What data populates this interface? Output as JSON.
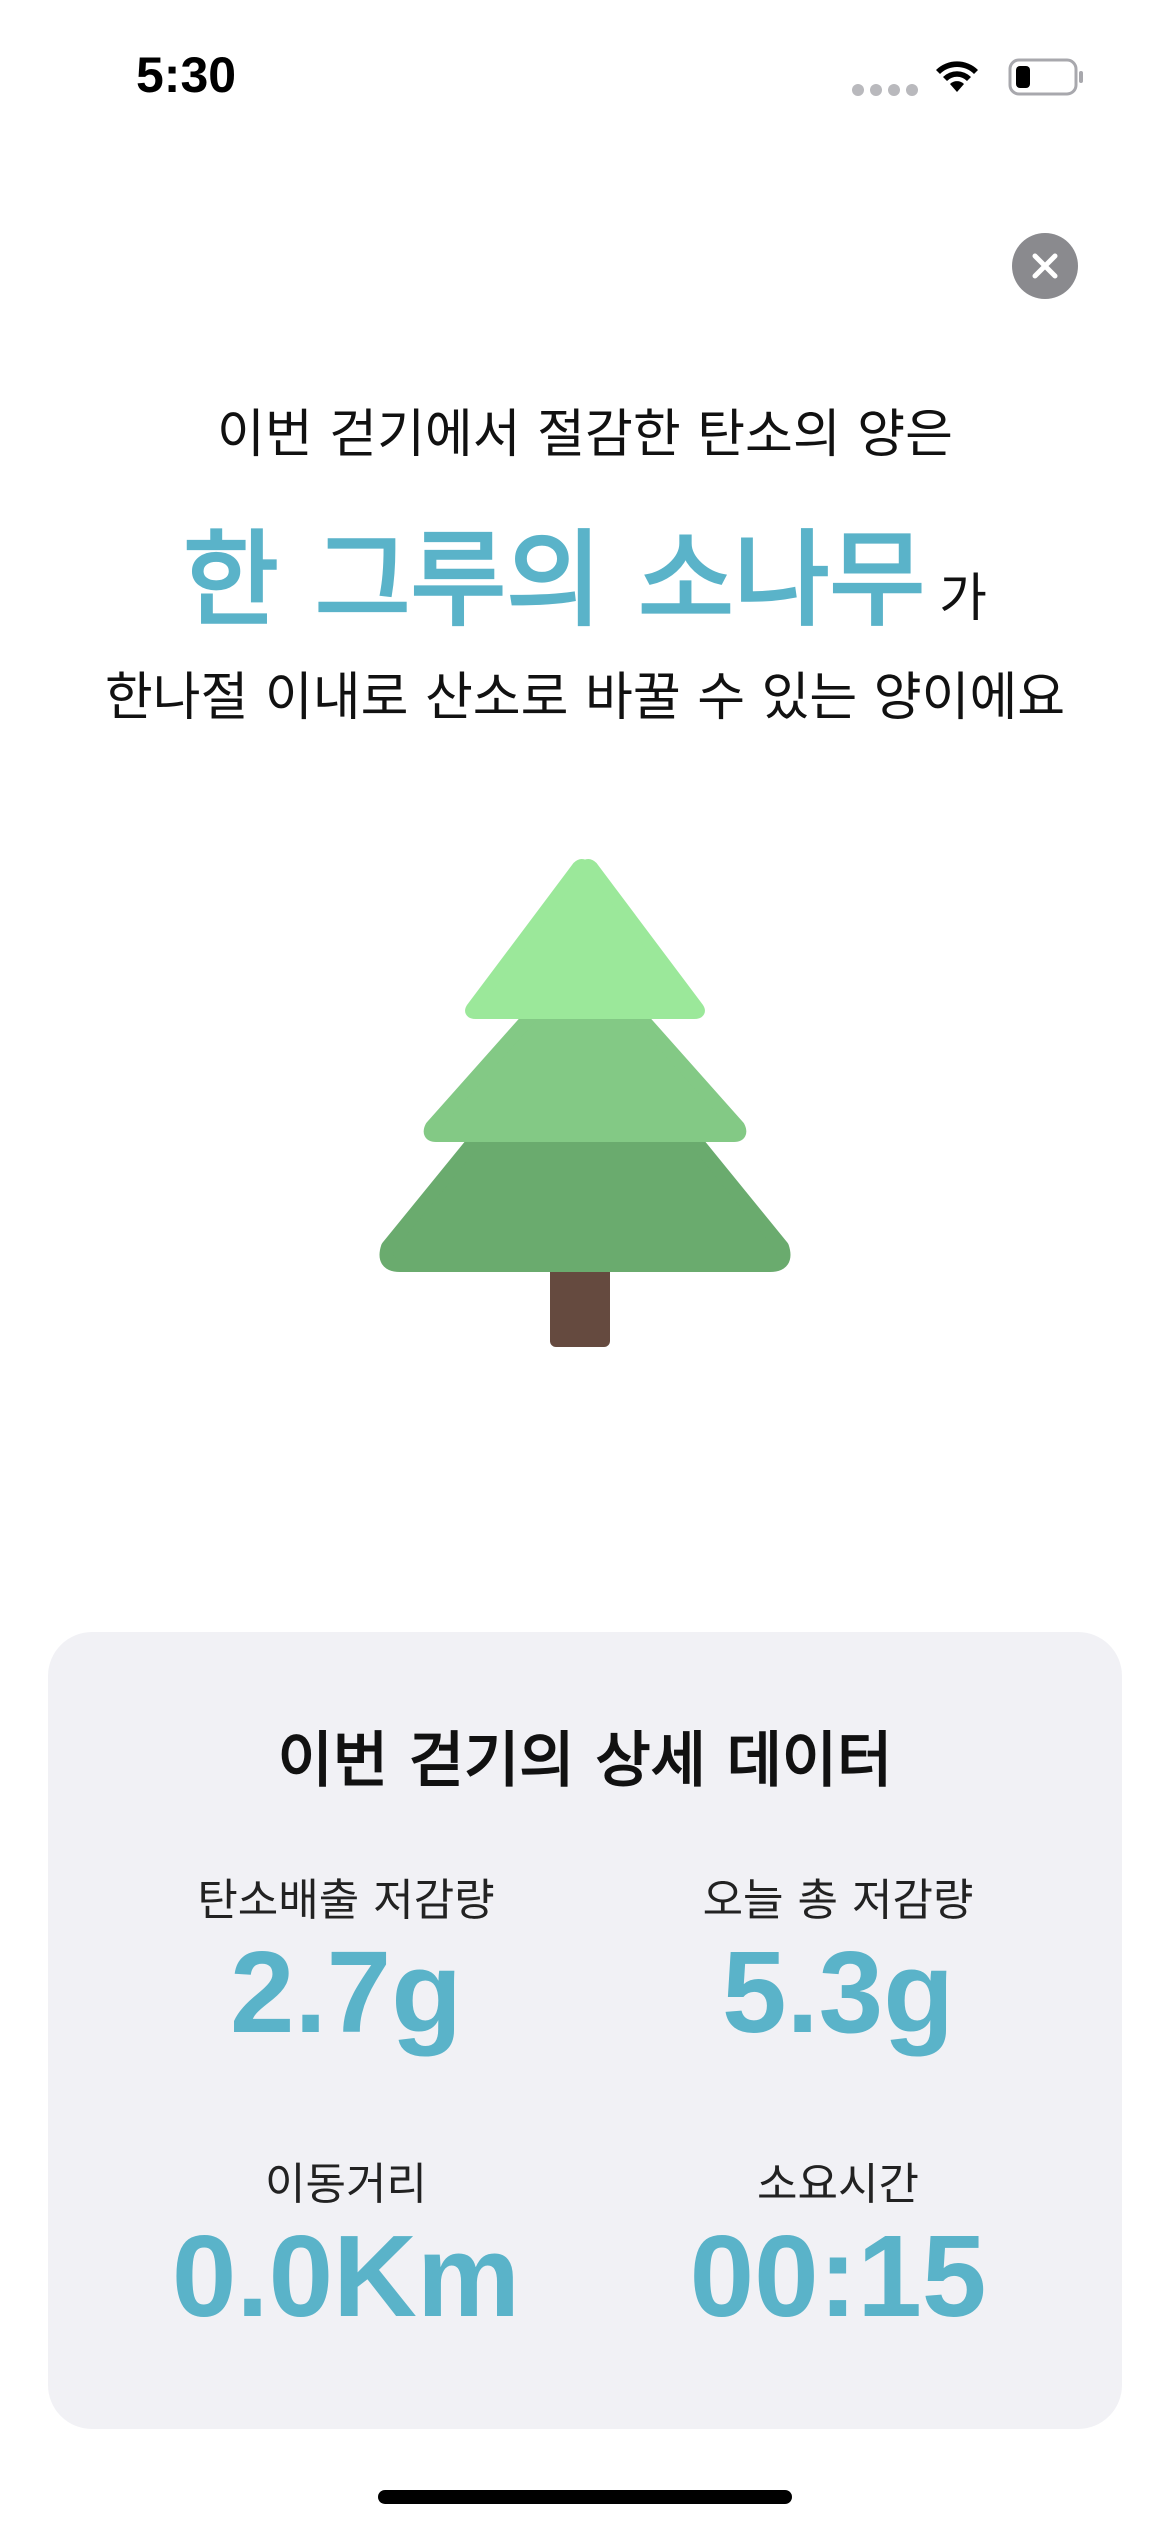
{
  "status_bar": {
    "time": "5:30"
  },
  "headline": {
    "line1": "이번 걷기에서 절감한 탄소의 양은",
    "highlight": "한 그루의 소나무",
    "particle": "가",
    "line3": "한나절 이내로 산소로 바꿀 수 있는 양이에요"
  },
  "colors": {
    "accent": "#5ab3c9",
    "tree_top": "#9be89a",
    "tree_middle": "#83c985",
    "tree_bottom": "#6aab6e",
    "trunk": "#654a3f",
    "card_bg": "#f1f1f5",
    "close_bg": "#8a8a8e"
  },
  "detail": {
    "title": "이번 걷기의 상세 데이터",
    "stats": [
      {
        "label": "탄소배출 저감량",
        "value": "2.7g"
      },
      {
        "label": "오늘 총 저감량",
        "value": "5.3g"
      },
      {
        "label": "이동거리",
        "value": "0.0Km"
      },
      {
        "label": "소요시간",
        "value": "00:15"
      }
    ]
  },
  "icons": [
    "wifi-icon",
    "battery-icon",
    "close-icon",
    "tree-illustration"
  ]
}
